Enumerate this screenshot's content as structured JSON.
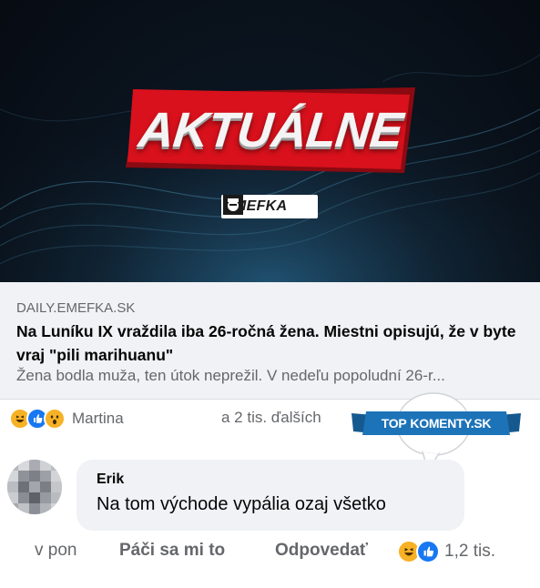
{
  "hero": {
    "headline": "AKTUÁLNE",
    "logo_text": "EMEFKA"
  },
  "preview": {
    "domain": "DAILY.EMEFKA.SK",
    "headline": "Na Luníku IX vraždila iba 26-ročná žena. Miestni opisujú, že v byte vraj \"pili marihuanu\"",
    "description": "Žena bodla muža, ten útok neprežil. V nedeľu popoludní 26-r..."
  },
  "reactions": {
    "icons": [
      "haha-icon",
      "like-icon",
      "wow-icon"
    ],
    "names": "Martina",
    "others": "a 2 tis. ďalších"
  },
  "badge": {
    "text_top": "TOP",
    "text_main": "KOMENTY.SK"
  },
  "comment": {
    "author": "Erik",
    "text": "Na tom východe vypália ozaj všetko",
    "time": "v pon",
    "like_label": "Páči sa mi to",
    "reply_label": "Odpovedať",
    "reaction_icons": [
      "haha-icon",
      "like-icon"
    ],
    "reaction_count": "1,2 tis."
  },
  "colors": {
    "accent_red": "#d8111c",
    "badge_blue": "#1d73b8",
    "like_blue": "#1877f2",
    "haha_yellow": "#f7b125"
  }
}
